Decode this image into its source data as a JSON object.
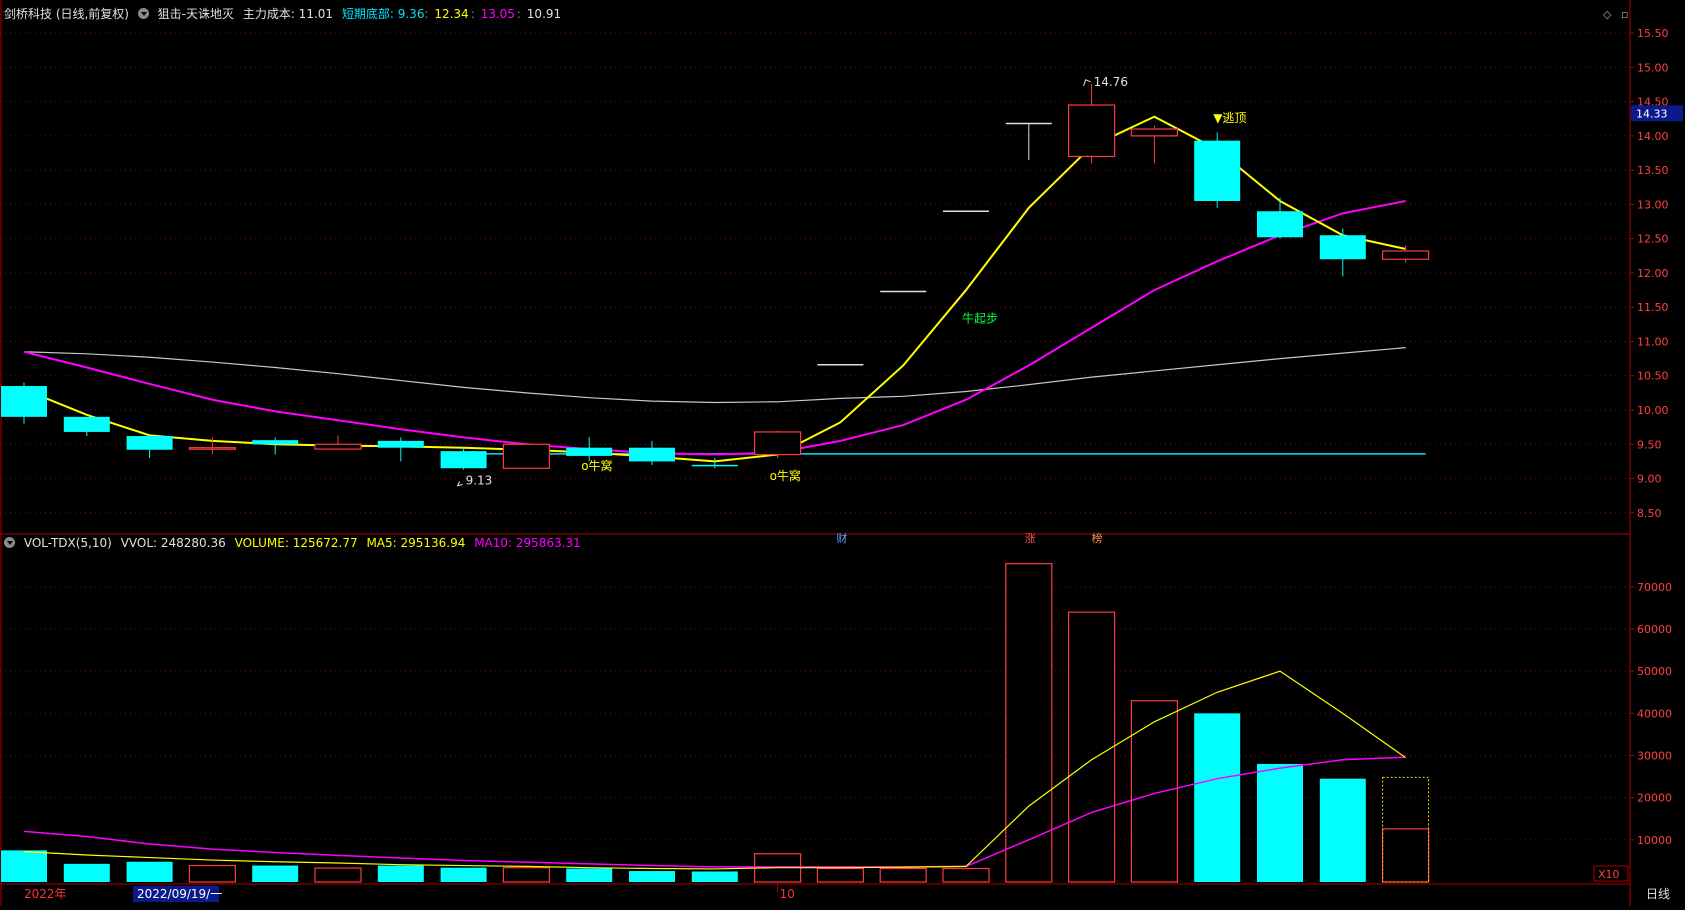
{
  "header": {
    "stock": "剑桥科技 (日线,前复权)",
    "indicator": "狙击-天诛地灭",
    "cost_label": "主力成本: 11.01",
    "bottom_label": "短期底部: 9.36",
    "v1": "12.34",
    "v2": "13.05",
    "v3": "10.91"
  },
  "vol_header": {
    "name": "VOL-TDX(5,10)",
    "vvol": "VVOL: 248280.36",
    "volume": "VOLUME: 125672.77",
    "ma5": "MA5: 295136.94",
    "ma10": "MA10: 295863.31"
  },
  "colors": {
    "up": "#ff3c3c",
    "down": "#00ffff",
    "ma_yellow": "#ffff00",
    "ma_magenta": "#ff00ff",
    "ma_white": "#c8c8c8",
    "axis": "#b00000",
    "cyan_line": "#00e5ff"
  },
  "price_axis": {
    "ticks": [
      "15.50",
      "15.00",
      "14.50",
      "14.00",
      "13.50",
      "13.00",
      "12.50",
      "12.00",
      "11.50",
      "11.00",
      "10.50",
      "10.00",
      "9.50",
      "9.00",
      "8.50"
    ],
    "current_price": "14.33"
  },
  "volume_axis": {
    "ticks": [
      "70000",
      "60000",
      "50000",
      "40000",
      "30000",
      "20000",
      "10000"
    ],
    "unit": "X10"
  },
  "bottom_bar": {
    "year": "2022年",
    "date": "2022/09/19/一",
    "month": "10",
    "period": "日线"
  },
  "annotations": {
    "high": "14.76",
    "low": "9.13",
    "niuwo1": "o牛窝",
    "niuwo2": "o牛窝",
    "niuqibu": "牛起步",
    "taoding": "▼逃顶",
    "cai": "财",
    "zhang": "涨",
    "bang": "榜"
  },
  "chart_data": {
    "type": "candlestick",
    "candles": [
      {
        "o": 10.35,
        "h": 10.4,
        "l": 9.8,
        "c": 9.9
      },
      {
        "o": 9.9,
        "h": 9.9,
        "l": 9.62,
        "c": 9.68
      },
      {
        "o": 9.62,
        "h": 9.65,
        "l": 9.3,
        "c": 9.42
      },
      {
        "o": 9.45,
        "h": 9.6,
        "l": 9.35,
        "c": 9.45
      },
      {
        "o": 9.56,
        "h": 9.6,
        "l": 9.35,
        "c": 9.5
      },
      {
        "o": 9.43,
        "h": 9.63,
        "l": 9.43,
        "c": 9.5
      },
      {
        "o": 9.55,
        "h": 9.6,
        "l": 9.25,
        "c": 9.45
      },
      {
        "o": 9.4,
        "h": 9.45,
        "l": 9.13,
        "c": 9.15
      },
      {
        "o": 9.15,
        "h": 9.5,
        "l": 9.15,
        "c": 9.5
      },
      {
        "o": 9.45,
        "h": 9.6,
        "l": 9.25,
        "c": 9.33
      },
      {
        "o": 9.45,
        "h": 9.55,
        "l": 9.2,
        "c": 9.25
      },
      {
        "o": 9.2,
        "h": 9.3,
        "l": 9.15,
        "c": 9.18
      },
      {
        "o": 9.35,
        "h": 9.7,
        "l": 9.3,
        "c": 9.68
      },
      {
        "o": 10.66,
        "h": 10.66,
        "l": 10.66,
        "c": 10.66
      },
      {
        "o": 11.73,
        "h": 11.73,
        "l": 11.73,
        "c": 11.73
      },
      {
        "o": 12.9,
        "h": 12.9,
        "l": 12.9,
        "c": 12.9
      },
      {
        "o": 14.18,
        "h": 14.18,
        "l": 13.65,
        "c": 14.18
      },
      {
        "o": 13.7,
        "h": 14.76,
        "l": 13.6,
        "c": 14.45
      },
      {
        "o": 14.0,
        "h": 14.15,
        "l": 13.6,
        "c": 14.1
      },
      {
        "o": 13.93,
        "h": 14.05,
        "l": 12.95,
        "c": 13.05
      },
      {
        "o": 12.9,
        "h": 13.1,
        "l": 12.5,
        "c": 12.52
      },
      {
        "o": 12.55,
        "h": 12.65,
        "l": 11.95,
        "c": 12.2
      },
      {
        "o": 12.2,
        "h": 12.4,
        "l": 12.15,
        "c": 12.32
      }
    ],
    "ma_yellow": [
      10.3,
      9.93,
      9.63,
      9.55,
      9.5,
      9.48,
      9.47,
      9.45,
      9.42,
      9.38,
      9.32,
      9.25,
      9.35,
      9.82,
      10.65,
      11.75,
      12.95,
      13.85,
      14.28,
      13.8,
      13.05,
      12.55,
      12.35
    ],
    "ma_magenta": [
      10.85,
      10.62,
      10.38,
      10.15,
      9.98,
      9.85,
      9.72,
      9.6,
      9.5,
      9.43,
      9.37,
      9.35,
      9.38,
      9.55,
      9.78,
      10.15,
      10.65,
      11.2,
      11.75,
      12.17,
      12.55,
      12.87,
      13.05
    ],
    "ma_white": [
      10.85,
      10.82,
      10.77,
      10.7,
      10.62,
      10.53,
      10.43,
      10.33,
      10.25,
      10.18,
      10.13,
      10.11,
      10.12,
      10.17,
      10.2,
      10.27,
      10.37,
      10.48,
      10.57,
      10.66,
      10.75,
      10.83,
      10.91
    ],
    "short_bottom_line": 9.36,
    "volumes": [
      7500,
      4300,
      4800,
      3900,
      3900,
      3300,
      3900,
      3400,
      3400,
      3200,
      2600,
      2500,
      6700,
      3200,
      3200,
      3200,
      75500,
      64000,
      43000,
      40000,
      28000,
      24500,
      12600
    ],
    "vol_ma_yellow": [
      7200,
      6400,
      5800,
      5200,
      4800,
      4500,
      4100,
      3900,
      3700,
      3400,
      3200,
      3100,
      3400,
      3400,
      3500,
      3700,
      18000,
      29000,
      38000,
      45000,
      50000,
      40000,
      29500
    ],
    "vol_ma_magenta": [
      12000,
      10800,
      9000,
      7800,
      7000,
      6300,
      5700,
      5100,
      4700,
      4300,
      3900,
      3600,
      3600,
      3600,
      3600,
      3700,
      10000,
      16500,
      21000,
      24500,
      27000,
      29000,
      29600
    ],
    "last_vol_est": 24800
  }
}
